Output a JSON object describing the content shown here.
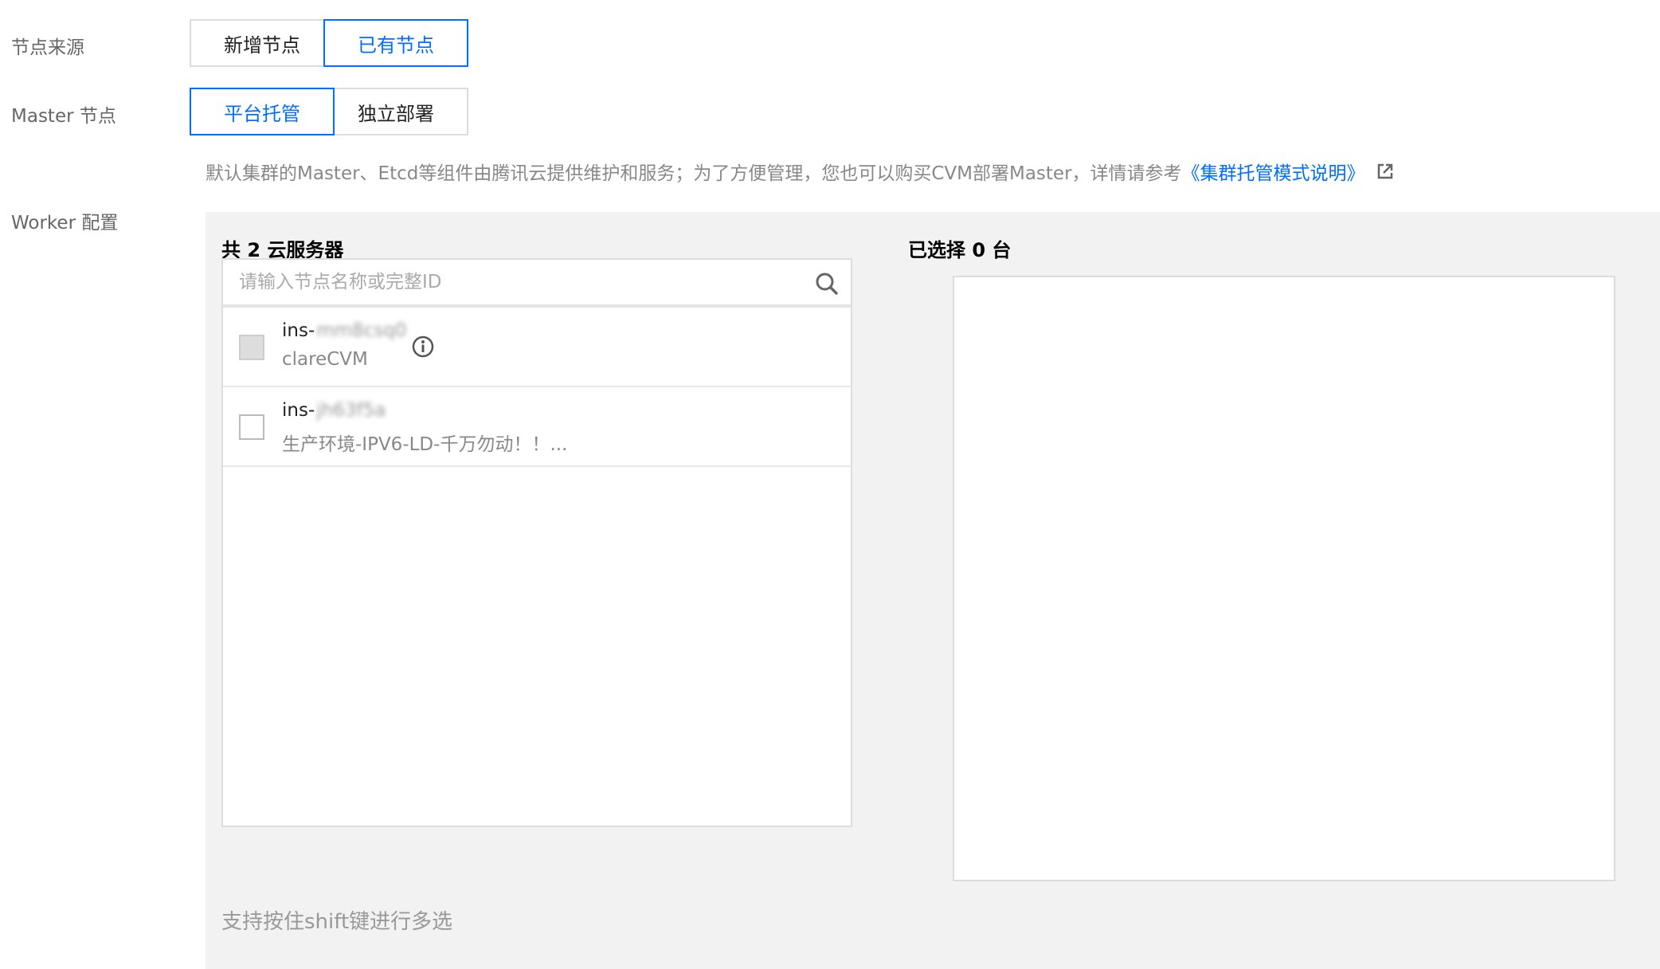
{
  "node_source": {
    "label": "节点来源",
    "options": [
      {
        "label": "新增节点",
        "selected": false
      },
      {
        "label": "已有节点",
        "selected": true
      }
    ]
  },
  "master": {
    "label": "Master 节点",
    "options": [
      {
        "label": "平台托管",
        "selected": true
      },
      {
        "label": "独立部署",
        "selected": false
      }
    ],
    "description": "默认集群的Master、Etcd等组件由腾讯云提供维护和服务；为了方便管理，您也可以购买CVM部署Master，详情请参考",
    "doc_link": "《集群托管模式说明》",
    "external_icon": "external-link-icon"
  },
  "worker": {
    "label": "Worker 配置",
    "available_title": "共 2 云服务器",
    "selected_title": "已选择 0 台",
    "search_placeholder": "请输入节点名称或完整ID",
    "instances": [
      {
        "id_prefix": "ins-",
        "id_blurred": "mm8csq0",
        "name": "clareCVM",
        "disabled": true,
        "has_info": true
      },
      {
        "id_prefix": "ins-",
        "id_blurred": "jh63f5a",
        "name": "生产环境-IPV6-LD-千万勿动！！...",
        "disabled": false,
        "has_info": false
      }
    ],
    "hint": "支持按住shift键进行多选"
  },
  "colors": {
    "primary": "#006eff",
    "panel_bg": "#f2f2f2",
    "border": "#dddddd"
  }
}
